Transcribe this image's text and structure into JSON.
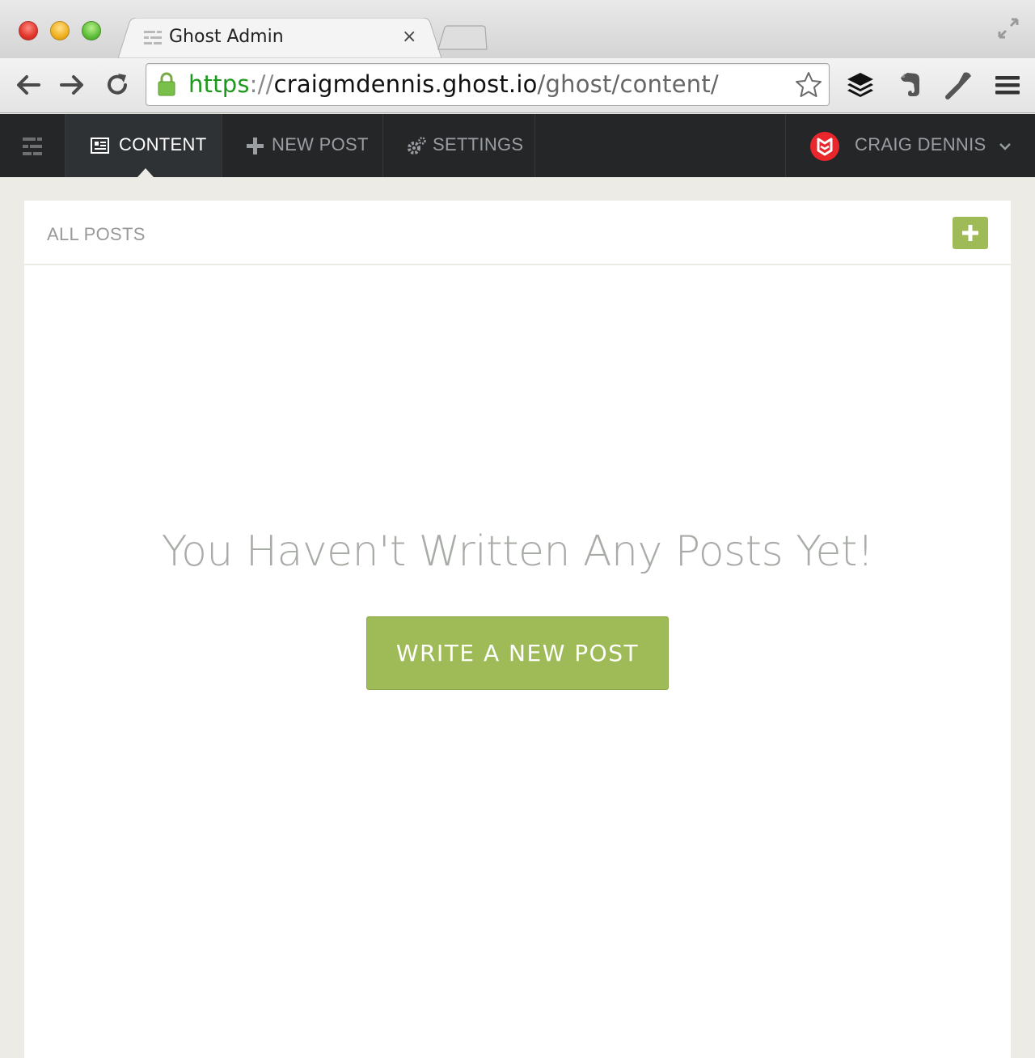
{
  "browser": {
    "tab_title": "Ghost Admin",
    "tab_close": "×",
    "url": {
      "scheme": "https",
      "separator": "://",
      "host": "craigmdennis.ghost.io",
      "path": "/ghost/content/"
    },
    "icons": [
      "back-arrow-icon",
      "forward-arrow-icon",
      "reload-icon",
      "lock-icon",
      "star-icon",
      "buffer-icon",
      "evernote-icon",
      "wrench-icon",
      "menu-icon",
      "fullscreen-icon"
    ]
  },
  "ghost_nav": {
    "content_label": "CONTENT",
    "new_post_label": "NEW POST",
    "settings_label": "SETTINGS",
    "user_name": "CRAIG DENNIS"
  },
  "panel": {
    "title": "ALL POSTS",
    "empty_message": "You Haven't Written Any Posts Yet!",
    "write_button": "WRITE A NEW POST"
  },
  "colors": {
    "accent_green": "#9fbb58",
    "nav_bg": "#242628",
    "page_bg": "#ecebe5",
    "avatar_red": "#e8262b"
  }
}
